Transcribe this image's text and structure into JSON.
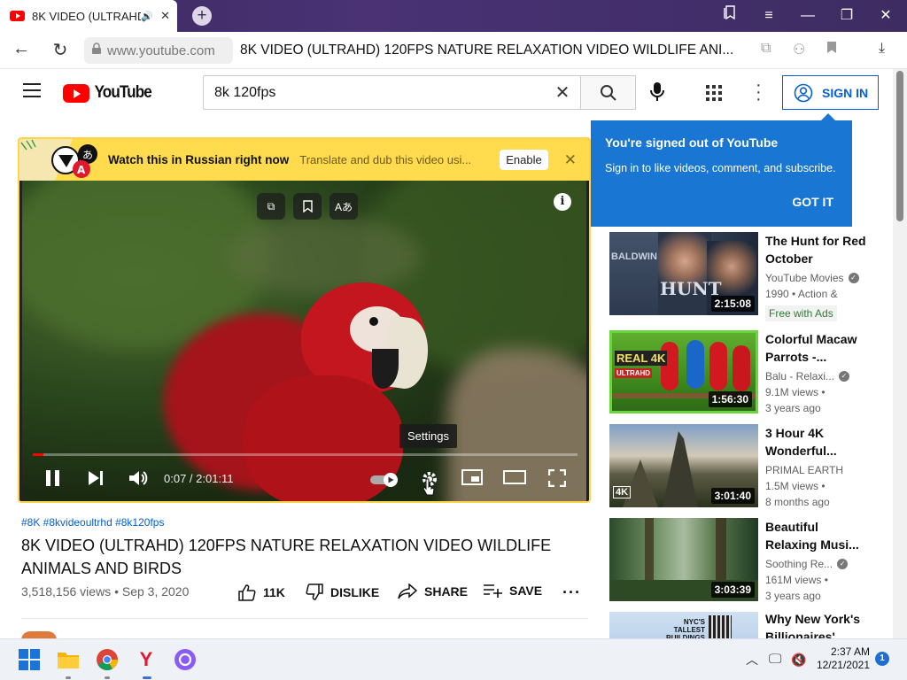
{
  "browser": {
    "tab_title": "8K VIDEO (ULTRAHD)",
    "domain": "www.youtube.com",
    "page_title": "8K VIDEO (ULTRAHD) 120FPS NATURE RELAXATION VIDEO WILDLIFE ANI..."
  },
  "youtube": {
    "logo_text": "YouTube",
    "search_query": "8k 120fps",
    "sign_in": "SIGN IN"
  },
  "translate_bar": {
    "title": "Watch this in Russian right now",
    "subtitle": "Translate and dub this video usi...",
    "enable": "Enable"
  },
  "player": {
    "tooltip": "Settings",
    "time": "0:07 / 2:01:11",
    "progress_fraction": 0.0001
  },
  "video": {
    "tags": "#8K #8kvideoultrhd #8k120fps",
    "title": "8K VIDEO (ULTRAHD) 120FPS NATURE RELAXATION VIDEO WILDLIFE ANIMALS AND BIRDS",
    "meta": "3,518,156 views • Sep 3, 2020",
    "likes": "11K",
    "dislike": "DISLIKE",
    "share": "SHARE",
    "save": "SAVE"
  },
  "popup": {
    "heading": "You're signed out of YouTube",
    "body": "Sign in to like videos, comment, and subscribe.",
    "button": "GOT IT"
  },
  "recommendations": [
    {
      "title": "The Hunt for Red October",
      "channel": "YouTube Movies",
      "views": "1990 • Action &",
      "age": "",
      "badge": "Free with Ads",
      "duration": "2:15:08",
      "thumb_text": "HUNT",
      "thumb_text2": "BALDWIN"
    },
    {
      "title": "Colorful Macaw Parrots -...",
      "channel": "Balu - Relaxi...",
      "views": "9.1M views •",
      "age": "3 years ago",
      "badge": "",
      "duration": "1:56:30",
      "thumb_text": "REAL 4K",
      "thumb_text2": "ULTRAHD"
    },
    {
      "title": "3 Hour 4K Wonderful...",
      "channel": "PRIMAL EARTH",
      "views": "1.5M views •",
      "age": "8 months ago",
      "badge": "",
      "duration": "3:01:40",
      "thumb_text": "4K",
      "thumb_text2": ""
    },
    {
      "title": "Beautiful Relaxing Musi...",
      "channel": "Soothing Re...",
      "views": "161M views •",
      "age": "3 years ago",
      "badge": "",
      "duration": "3:03:39",
      "thumb_text": "",
      "thumb_text2": ""
    },
    {
      "title": "Why New York's Billionaires'",
      "channel": "",
      "views": "",
      "age": "",
      "badge": "",
      "duration": "",
      "thumb_text": "NYC'S TALLEST BUILDINGS",
      "thumb_text2": ""
    }
  ],
  "taskbar": {
    "time": "2:37 AM",
    "date": "12/21/2021",
    "notifications": "1"
  }
}
